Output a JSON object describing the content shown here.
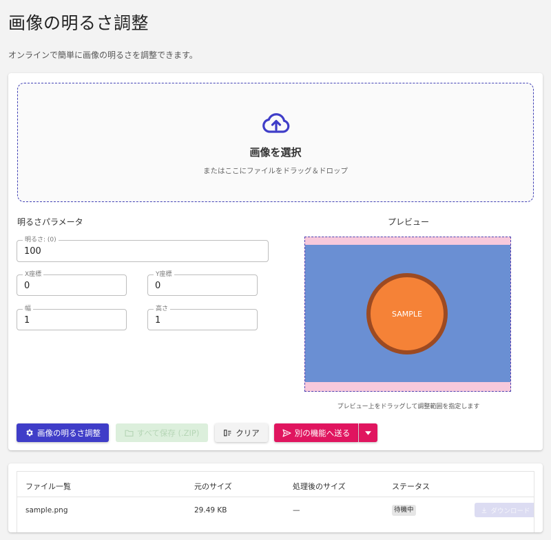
{
  "page": {
    "title": "画像の明るさ調整",
    "subtitle": "オンラインで簡単に画像の明るさを調整できます。"
  },
  "dropzone": {
    "icon": "cloud-upload-icon",
    "title": "画像を選択",
    "hint": "またはここにファイルをドラッグ＆ドロップ"
  },
  "params": {
    "title": "明るさパラメータ",
    "brightness": {
      "label": "明るさ: (0)",
      "value": "100"
    },
    "x": {
      "label": "X座標",
      "value": "0"
    },
    "y": {
      "label": "Y座標",
      "value": "0"
    },
    "width": {
      "label": "幅",
      "value": "1"
    },
    "height": {
      "label": "高さ",
      "value": "1"
    }
  },
  "preview": {
    "title": "プレビュー",
    "sample_text": "SAMPLE",
    "hint": "プレビュー上をドラッグして調整範囲を指定します"
  },
  "actions": {
    "adjust": "画像の明るさ調整",
    "save_all": "すべて保存 (.ZIP)",
    "clear": "クリア",
    "send": "別の機能へ送る"
  },
  "files": {
    "columns": [
      "ファイル一覧",
      "元のサイズ",
      "処理後のサイズ",
      "ステータス"
    ],
    "rows": [
      {
        "name": "sample.png",
        "original_size": "29.49 KB",
        "processed_size": "—",
        "status": "待機中",
        "download": "ダウンロード"
      }
    ]
  },
  "colors": {
    "primary": "#3f3dc8",
    "accent": "#e0155f",
    "save_disabled": "#dcefdc",
    "preview_background": "#6a8fd3",
    "sample_fill": "#f58237",
    "sample_border": "#9c4a22"
  }
}
